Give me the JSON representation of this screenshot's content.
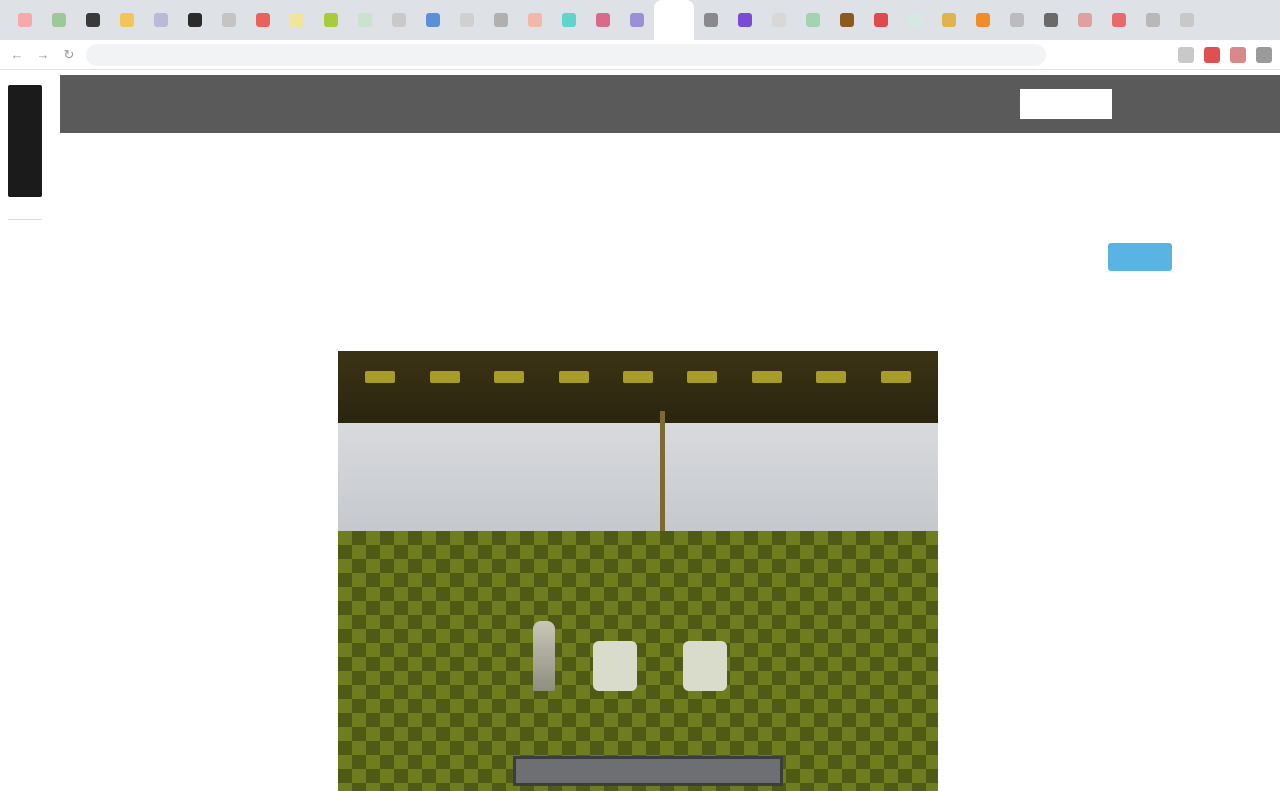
{
  "browser": {
    "tab_favicon_colors": [
      "#f7a8a8",
      "#9cc99a",
      "#3a3a3a",
      "#f2c45a",
      "#bbb8d8",
      "#2b2b2b",
      "#c4c4c4",
      "#e8645a",
      "#f1e59a",
      "#a6cc3c",
      "#c9e3cd",
      "#c9c9c9",
      "#5b8fd8",
      "#d0d0d0",
      "#b0b0b0",
      "#f2b8a6",
      "#5fd4c8",
      "#d86a8a",
      "#9b8fd6",
      "#ffffff",
      "#8a8a8a",
      "#7a4bd6",
      "#d8d8d8",
      "#a3d4b2",
      "#8a5a1e",
      "#e04a4a",
      "#d6e8e2",
      "#e0b44c",
      "#f08c2a",
      "#bcbcbc",
      "#6a6a6a",
      "#e0a0a0",
      "#e86a6a",
      "#b8b8b8",
      "#c8c8c8"
    ],
    "active_tab_index": 19,
    "back_icon": "back-arrow-icon",
    "forward_icon": "forward-arrow-icon",
    "reload_icon": "reload-icon",
    "url": "",
    "extension_colors": [
      "#c9c9c9",
      "#e05050",
      "#d68a8a",
      "#9a9a9a"
    ]
  },
  "rail": {
    "logo_text": "",
    "menu_label": ""
  },
  "cookie_banner": {
    "text": "",
    "button_label": ""
  },
  "article": {
    "title": "",
    "author": "",
    "date": ""
  },
  "sidebar": {
    "heading": "",
    "text": "",
    "button_label": ""
  }
}
